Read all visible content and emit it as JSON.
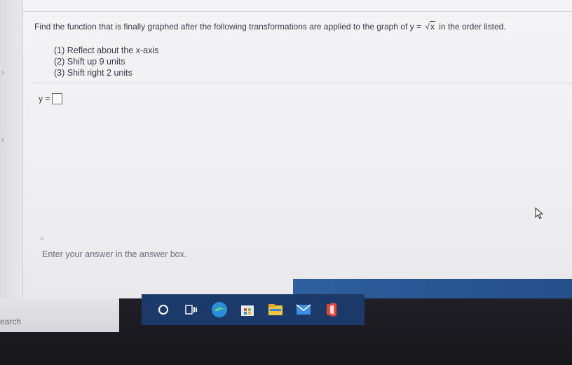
{
  "question": {
    "prefix": "Find the function that is finally graphed after the following transformations are applied to the graph of y =",
    "radicand": "x",
    "suffix": "in the order listed."
  },
  "steps": [
    "(1)  Reflect about the x-axis",
    "(2)  Shift up 9 units",
    "(3)  Shift right 2 units"
  ],
  "answer": {
    "label": "y =",
    "value": ""
  },
  "hint": "Enter your answer in the answer box.",
  "taskbar": {
    "search_text": "earch",
    "icons": [
      "cortana-icon",
      "task-view-icon",
      "edge-icon",
      "store-icon",
      "file-explorer-icon",
      "mail-icon",
      "office-icon"
    ]
  },
  "colors": {
    "taskbar_highlight": "#1b3a6a",
    "blue_band": "#2f5f9e",
    "text": "#3a3a44"
  }
}
